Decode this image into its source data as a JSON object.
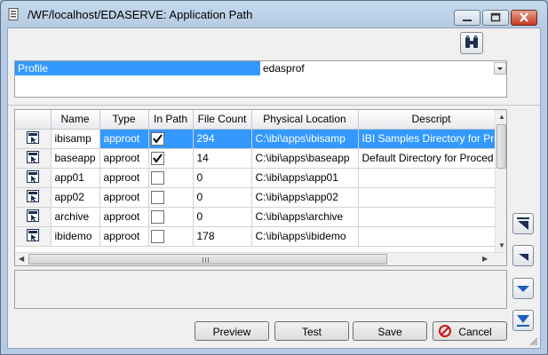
{
  "window": {
    "title": "/WF/localhost/EDASERVE: Application Path"
  },
  "profile": {
    "label": "Profile",
    "value": "edasprof"
  },
  "grid": {
    "columns": [
      "Name",
      "Type",
      "In Path",
      "File Count",
      "Physical Location",
      "Descript"
    ],
    "rows": [
      {
        "name": "ibisamp",
        "type": "approot",
        "in_path": true,
        "file_count": "294",
        "location": "C:\\ibi\\apps\\ibisamp",
        "description": "IBI Samples Directory for Proc"
      },
      {
        "name": "baseapp",
        "type": "approot",
        "in_path": true,
        "file_count": "14",
        "location": "C:\\ibi\\apps\\baseapp",
        "description": "Default Directory for Proced"
      },
      {
        "name": "app01",
        "type": "approot",
        "in_path": false,
        "file_count": "0",
        "location": "C:\\ibi\\apps\\app01",
        "description": ""
      },
      {
        "name": "app02",
        "type": "approot",
        "in_path": false,
        "file_count": "0",
        "location": "C:\\ibi\\apps\\app02",
        "description": ""
      },
      {
        "name": "archive",
        "type": "approot",
        "in_path": false,
        "file_count": "0",
        "location": "C:\\ibi\\apps\\archive",
        "description": ""
      },
      {
        "name": "ibidemo",
        "type": "approot",
        "in_path": false,
        "file_count": "178",
        "location": "C:\\ibi\\apps\\ibidemo",
        "description": ""
      }
    ],
    "selected_row": 0
  },
  "buttons": {
    "preview": "Preview",
    "test": "Test",
    "save": "Save",
    "cancel": "Cancel"
  },
  "icons": {
    "app": "document-icon",
    "find": "binoculars-icon",
    "row": "row-arrow-icon",
    "move_top": "move-top-icon",
    "move_up": "move-up-icon",
    "move_down": "move-down-icon",
    "move_bottom": "move-bottom-icon",
    "cancel": "no-entry-icon"
  },
  "colors": {
    "selection": "#3399ff",
    "accent_blue": "#1f5fbf",
    "cancel_red": "#d01010"
  }
}
